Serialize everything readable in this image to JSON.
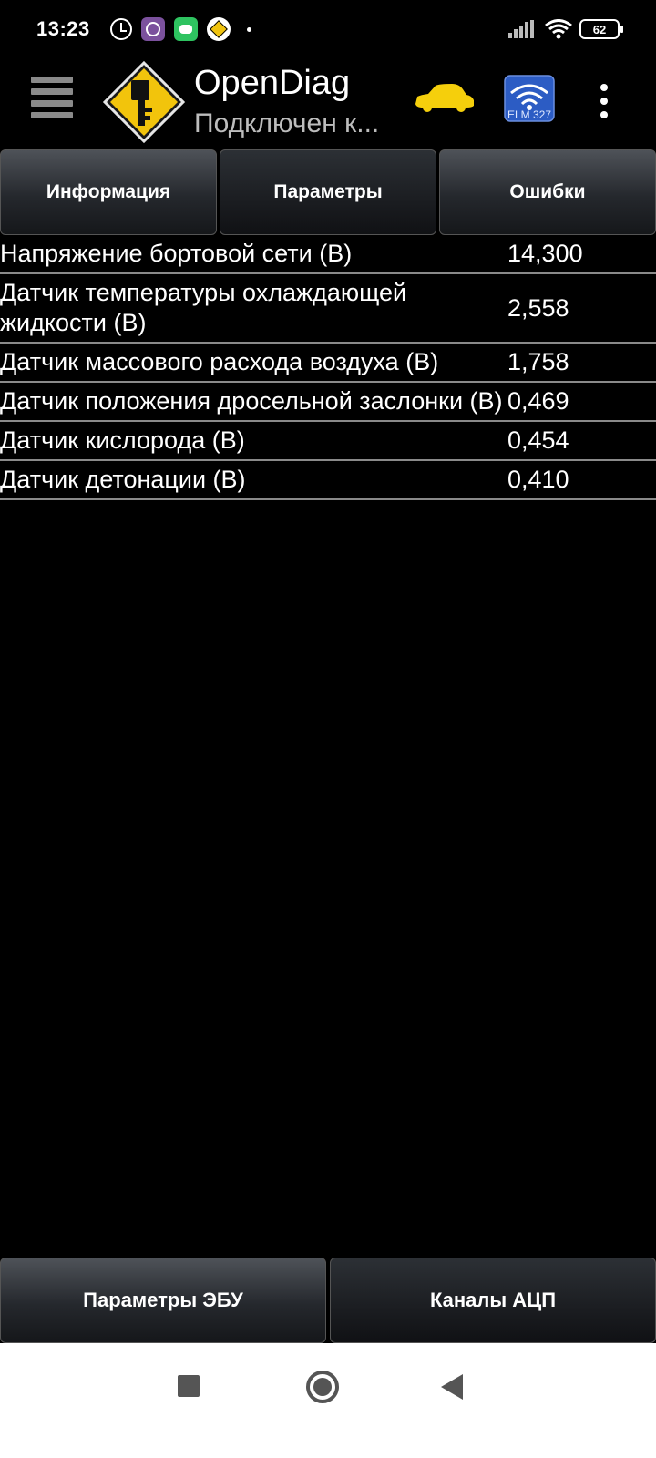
{
  "status_bar": {
    "time": "13:23",
    "battery": "62",
    "icons": [
      "alarm-icon",
      "viber-icon",
      "chat-icon",
      "opendiag-notification-icon",
      "dot-icon",
      "signal-icon",
      "wifi-icon",
      "battery-icon"
    ]
  },
  "app_bar": {
    "title": "OpenDiag",
    "subtitle": "Подключен к...",
    "icons": [
      "hamburger-icon",
      "app-logo-icon",
      "car-icon",
      "elm327-icon",
      "overflow-menu-icon"
    ],
    "car_color": "#f5cf0c",
    "elm_label": "ELM 327"
  },
  "tabs": [
    {
      "label": "Информация",
      "active": false
    },
    {
      "label": "Параметры",
      "active": true
    },
    {
      "label": "Ошибки",
      "active": false
    }
  ],
  "parameters": [
    {
      "label": "Напряжение бортовой сети (В)",
      "value": "14,300"
    },
    {
      "label": "Датчик температуры охлаждающей жидкости (В)",
      "value": "2,558"
    },
    {
      "label": "Датчик массового расхода воздуха (В)",
      "value": "1,758"
    },
    {
      "label": "Датчик положения дросельной заслонки (В)",
      "value": "0,469"
    },
    {
      "label": "Датчик кислорода (В)",
      "value": "0,454"
    },
    {
      "label": "Датчик детонации (В)",
      "value": "0,410"
    }
  ],
  "bottom_tabs": [
    {
      "label": "Параметры ЭБУ",
      "active": false
    },
    {
      "label": "Каналы АЦП",
      "active": true
    }
  ],
  "nav_bar": {
    "icons": [
      "recents-square-icon",
      "home-circle-icon",
      "back-triangle-icon"
    ]
  }
}
